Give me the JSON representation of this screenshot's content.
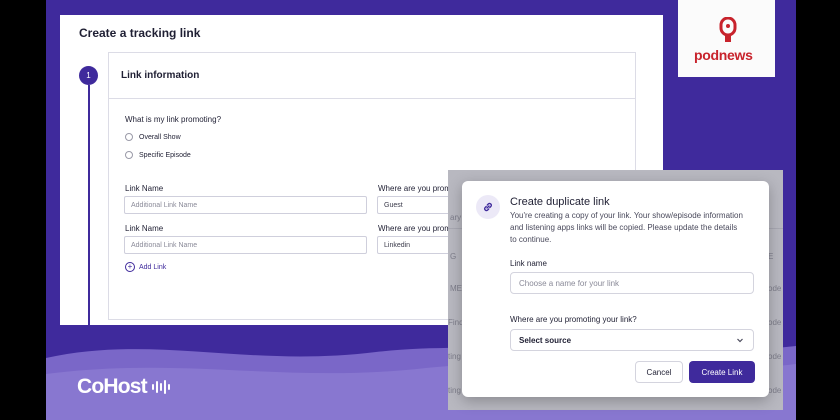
{
  "form": {
    "title": "Create a tracking link",
    "step_number": "1",
    "section_title": "Link information",
    "question": "What is my link promoting?",
    "options": [
      "Overall Show",
      "Specific Episode"
    ],
    "rows": [
      {
        "link_name_label": "Link Name",
        "link_name_placeholder": "Additional Link Name",
        "promo_label": "Where are you promo",
        "promo_value": "Guest"
      },
      {
        "link_name_label": "Link Name",
        "link_name_placeholder": "Additional Link Name",
        "promo_label": "Where are you promo",
        "promo_value": "Linkedin"
      }
    ],
    "add_link_label": "Add Link"
  },
  "backdrop": {
    "fragments": [
      "ary",
      "G",
      "E",
      "ME",
      "ode",
      "Find",
      "ode",
      "ting",
      "ode",
      "ting",
      "ode"
    ]
  },
  "modal": {
    "title": "Create duplicate link",
    "description": "You're creating a copy of your link. Your show/episode information and listening apps links will be copied. Please update the details to continue.",
    "link_name_label": "Link name",
    "link_name_placeholder": "Choose a name for your link",
    "promo_label": "Where are you promoting your link?",
    "promo_select_value": "Select source",
    "cancel_label": "Cancel",
    "create_label": "Create Link",
    "icon": "link-icon"
  },
  "brands": {
    "podnews": "podnews",
    "cohost": "CoHost"
  },
  "colors": {
    "brand_purple": "#3f2a9c",
    "podnews_red": "#c8232c"
  }
}
